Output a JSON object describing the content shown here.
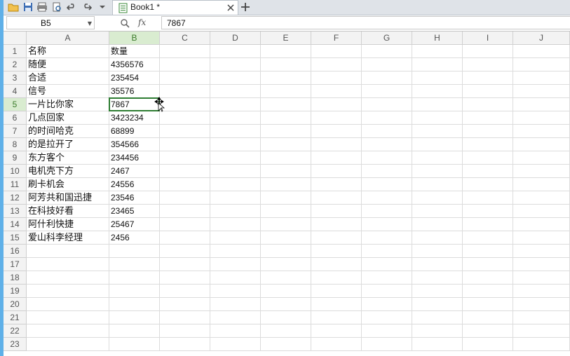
{
  "tab": {
    "title": "Book1 *"
  },
  "formula_bar": {
    "name_box": "B5",
    "fx": "fx",
    "value": "7867"
  },
  "columns": [
    "A",
    "B",
    "C",
    "D",
    "E",
    "F",
    "G",
    "H",
    "I",
    "J"
  ],
  "rows": [
    "1",
    "2",
    "3",
    "4",
    "5",
    "6",
    "7",
    "8",
    "9",
    "10",
    "11",
    "12",
    "13",
    "14",
    "15",
    "16",
    "17",
    "18",
    "19",
    "20",
    "21",
    "22",
    "23"
  ],
  "selected": {
    "column": "B",
    "row": "5"
  },
  "data": [
    [
      "名称",
      "数量"
    ],
    [
      "随便",
      "4356576"
    ],
    [
      "合适",
      "235454"
    ],
    [
      "信号",
      "35576"
    ],
    [
      "一片比你家",
      "7867"
    ],
    [
      "几点回家",
      "3423234"
    ],
    [
      "的时间哈克",
      "68899"
    ],
    [
      "的是拉开了",
      "354566"
    ],
    [
      "东方客个",
      "234456"
    ],
    [
      "电机壳下方",
      "2467"
    ],
    [
      "刷卡机会",
      "24556"
    ],
    [
      "阿芳共和国迅捷",
      "23546"
    ],
    [
      "在科技好看",
      "23465"
    ],
    [
      "阿什利快捷",
      "25467"
    ],
    [
      "爱山科李经理",
      "2456"
    ]
  ],
  "colors": {
    "accent": "#2e7d32",
    "header_selected": "#d9ecd0"
  }
}
